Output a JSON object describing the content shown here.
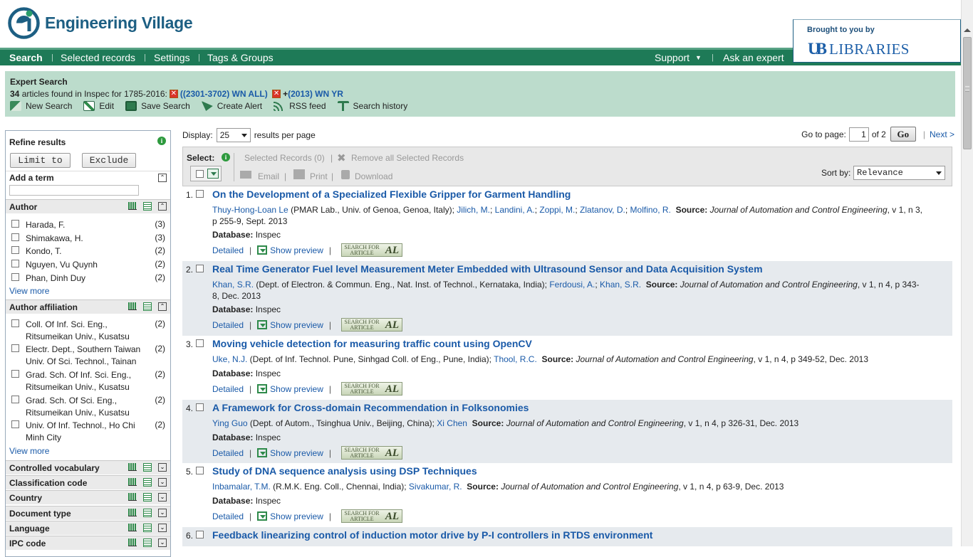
{
  "header": {
    "logo_text": "Engineering Village",
    "brought_by": "Brought to you by",
    "ub_mark": "UB",
    "libraries": "LIBRARIES"
  },
  "nav": {
    "search": "Search",
    "selected_records": "Selected records",
    "settings": "Settings",
    "tags_groups": "Tags & Groups",
    "support": "Support",
    "ask_expert": "Ask an expert"
  },
  "expert": {
    "title": "Expert Search",
    "count": "34",
    "found_text": "articles found in Inspec for 1785-2016:",
    "query1": "((2301-3702) WN ALL)",
    "plus": "+",
    "query2": "(2013) WN YR",
    "actions": [
      "New Search",
      "Edit",
      "Save Search",
      "Create Alert",
      "RSS feed",
      "Search history"
    ]
  },
  "sidebar": {
    "refine_title": "Refine results",
    "limit_to": "Limit to",
    "exclude": "Exclude",
    "add_term": "Add a term",
    "author_head": "Author",
    "authors": [
      {
        "name": "Harada, F.",
        "count": "(3)"
      },
      {
        "name": "Shimakawa, H.",
        "count": "(3)"
      },
      {
        "name": "Kondo, T.",
        "count": "(2)"
      },
      {
        "name": "Nguyen, Vu Quynh",
        "count": "(2)"
      },
      {
        "name": "Phan, Dinh Duy",
        "count": "(2)"
      }
    ],
    "view_more": "View more",
    "affil_head": "Author affiliation",
    "affiliations": [
      {
        "name": "Coll. Of Inf. Sci. Eng., Ritsumeikan Univ., Kusatsu",
        "count": "(2)"
      },
      {
        "name": "Electr. Dept., Southern Taiwan Univ. Of Sci. Technol., Tainan",
        "count": "(2)"
      },
      {
        "name": "Grad. Sch. Of Inf. Sci. Eng., Ritsumeikan Univ., Kusatsu",
        "count": "(2)"
      },
      {
        "name": "Grad. Sch. Of Sci. Eng., Ritsumeikan Univ., Kusatsu",
        "count": "(2)"
      },
      {
        "name": "Univ. Of Inf. Technol., Ho Chi Minh City",
        "count": "(2)"
      }
    ],
    "collapsed": [
      "Controlled vocabulary",
      "Classification code",
      "Country",
      "Document type",
      "Language",
      "IPC code"
    ]
  },
  "results_bar": {
    "display_label": "Display:",
    "per_page": "25",
    "per_page_suffix": "results per page",
    "goto_label": "Go to page:",
    "page": "1",
    "of": "of 2",
    "go": "Go",
    "next": "Next >",
    "select_label": "Select:",
    "selected_records": "Selected Records (0)",
    "remove_all": "Remove all Selected Records",
    "email": "Email",
    "print": "Print",
    "download": "Download",
    "sort_label": "Sort by:",
    "sort_value": "Relevance"
  },
  "labels": {
    "database": "Database:",
    "source": "Source:",
    "detailed": "Detailed",
    "show_preview": "Show preview",
    "sfa": "SEARCH FOR ARTICLE",
    "al": "AL"
  },
  "results": [
    {
      "num": "1.",
      "title": "On the Development of a Specialized Flexible Gripper for Garment Handling",
      "first_author": "Thuy-Hong-Loan Le",
      "affil": " (PMAR Lab., Univ. of Genoa, Genoa, Italy); ",
      "other_authors": [
        "Jilich, M.",
        "Landini, A.",
        "Zoppi, M.",
        "Zlatanov, D.",
        "Molfino, R."
      ],
      "journal": "Journal of Automation and Control Engineering",
      "details": ", v 1, n 3, p 255-9, Sept. 2013",
      "database": "Inspec"
    },
    {
      "num": "2.",
      "title": "Real Time Generator Fuel level Measurement Meter Embedded with Ultrasound Sensor and Data Acquisition System",
      "first_author": "Khan, S.R.",
      "affil": " (Dept. of Electron. & Commun. Eng., Nat. Inst. of Technol., Kernataka, India); ",
      "other_authors": [
        "Ferdousi, A.",
        "Khan, S.R."
      ],
      "journal": "Journal of Automation and Control Engineering",
      "details": ", v 1, n 4, p 343-8, Dec. 2013",
      "database": "Inspec"
    },
    {
      "num": "3.",
      "title": "Moving vehicle detection for measuring traffic count using OpenCV",
      "first_author": "Uke, N.J.",
      "affil": " (Dept. of Inf. Technol. Pune, Sinhgad Coll. of Eng., Pune, India); ",
      "other_authors": [
        "Thool, R.C."
      ],
      "journal": "Journal of Automation and Control Engineering",
      "details": ", v 1, n 4, p 349-52, Dec. 2013",
      "database": "Inspec"
    },
    {
      "num": "4.",
      "title": "A Framework for Cross-domain Recommendation in Folksonomies",
      "first_author": "Ying Guo",
      "affil": " (Dept. of Autom., Tsinghua Univ., Beijing, China); ",
      "other_authors": [
        "Xi Chen"
      ],
      "journal": "Journal of Automation and Control Engineering",
      "details": ", v 1, n 4, p 326-31, Dec. 2013",
      "database": "Inspec"
    },
    {
      "num": "5.",
      "title": "Study of DNA sequence analysis using DSP Techniques",
      "first_author": "Inbamalar, T.M.",
      "affil": " (R.M.K. Eng. Coll., Chennai, India); ",
      "other_authors": [
        "Sivakumar, R."
      ],
      "journal": "Journal of Automation and Control Engineering",
      "details": ", v 1, n 4, p 63-9, Dec. 2013",
      "database": "Inspec"
    },
    {
      "num": "6.",
      "title": "Feedback linearizing control of induction motor drive by P-I controllers in RTDS environment"
    }
  ],
  "colors": {
    "nav_green": "#1e7a57",
    "expert_bg": "#bcdccc",
    "link_blue": "#1a5aa8",
    "alt_row": "#e6eaee"
  }
}
